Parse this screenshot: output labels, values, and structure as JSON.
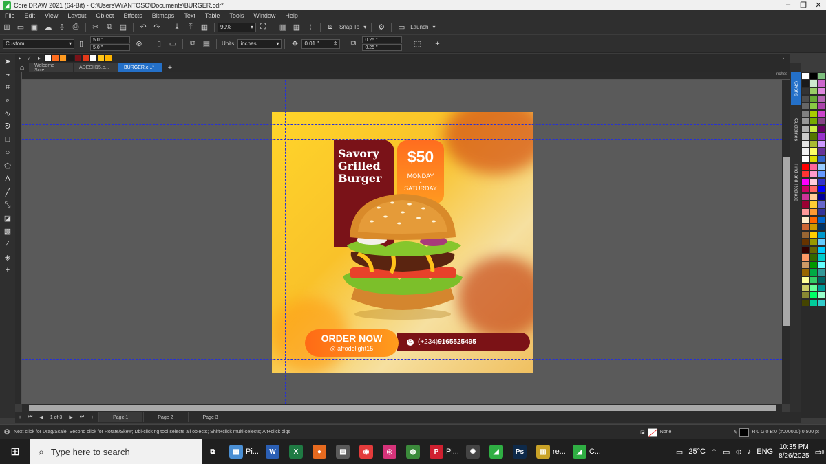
{
  "window": {
    "title": "CorelDRAW 2021 (64-Bit) - C:\\Users\\AYANTOSO\\Documents\\BURGER.cdr*"
  },
  "menu": [
    "File",
    "Edit",
    "View",
    "Layout",
    "Object",
    "Effects",
    "Bitmaps",
    "Text",
    "Table",
    "Tools",
    "Window",
    "Help"
  ],
  "toolbar": {
    "zoom": "90%",
    "snap_to": "Snap To",
    "launch": "Launch"
  },
  "property_bar": {
    "page_preset": "Custom",
    "width": "5.0 \"",
    "height": "5.0 \"",
    "units_label": "Units:",
    "units_value": "inches",
    "nudge": "0.01 \"",
    "dup_x": "0.25 \"",
    "dup_y": "0.25 \""
  },
  "doc_tabs": [
    {
      "label": "Welcome Scre...",
      "active": false
    },
    {
      "label": "ADESH15.c...",
      "active": false
    },
    {
      "label": "BURGER.c...*",
      "active": true
    }
  ],
  "ruler_unit": "inches",
  "poster": {
    "title_lines": [
      "Savory",
      "Grilled",
      "Burger"
    ],
    "price": "$50",
    "days_line1": "MONDAY",
    "days_line2": "-",
    "days_line3": "SATURDAY",
    "order_label": "ORDER NOW",
    "handle": "afrodelight15",
    "phone_prefix": "(+234)",
    "phone_number": "9165525495",
    "colors": {
      "maroon": "#7a1218",
      "orange": "#ff7a1a",
      "yellow": "#ffd52a"
    }
  },
  "dockers": [
    "Glyphs",
    "Guidelines",
    "Find and Replace"
  ],
  "pages": {
    "counter": "1 of 3",
    "tabs": [
      "Page 1",
      "Page 2",
      "Page 3"
    ]
  },
  "status": {
    "hint": "Next click for Drag/Scale; Second click for Rotate/Skew; Dbl-clicking tool selects all objects; Shift+click multi-selects; Alt+click digs",
    "fill": "None",
    "outline": "R:0 G:0 B:0 (#000000)  0.500 pt"
  },
  "taskbar": {
    "search_placeholder": "Type here to search",
    "apps": [
      {
        "icon": "photos-icon",
        "label": "Pi...",
        "color": "#4a8fd4",
        "glyph": "▦"
      },
      {
        "icon": "word-icon",
        "label": "",
        "color": "#2b5fb4",
        "glyph": "W"
      },
      {
        "icon": "excel-icon",
        "label": "",
        "color": "#1f7a43",
        "glyph": "X"
      },
      {
        "icon": "firefox-icon",
        "label": "",
        "color": "#e66a1f",
        "glyph": "●"
      },
      {
        "icon": "calendar-icon",
        "label": "",
        "color": "#5a5a5a",
        "glyph": "▤"
      },
      {
        "icon": "app-red-icon",
        "label": "",
        "color": "#e33b3b",
        "glyph": "◉"
      },
      {
        "icon": "instagram-icon",
        "label": "",
        "color": "#d6337a",
        "glyph": "◎"
      },
      {
        "icon": "chrome-icon",
        "label": "",
        "color": "#3b8a3b",
        "glyph": "◍"
      },
      {
        "icon": "pinterest-icon",
        "label": "Pi...",
        "color": "#cf2030",
        "glyph": "P"
      },
      {
        "icon": "chatgpt-icon",
        "label": "",
        "color": "#444444",
        "glyph": "✺"
      },
      {
        "icon": "corel-icon",
        "label": "",
        "color": "#2fae43",
        "glyph": "◢"
      },
      {
        "icon": "photoshop-icon",
        "label": "",
        "color": "#0e2a4a",
        "glyph": "Ps"
      },
      {
        "icon": "docs-icon",
        "label": "re...",
        "color": "#c9a227",
        "glyph": "▥"
      },
      {
        "icon": "coreldraw-icon",
        "label": "C...",
        "color": "#2fae43",
        "glyph": "◢"
      }
    ],
    "weather": "25°C",
    "lang": "ENG",
    "time": "10:35 PM",
    "date": "8/26/2025",
    "notifications": "10"
  }
}
